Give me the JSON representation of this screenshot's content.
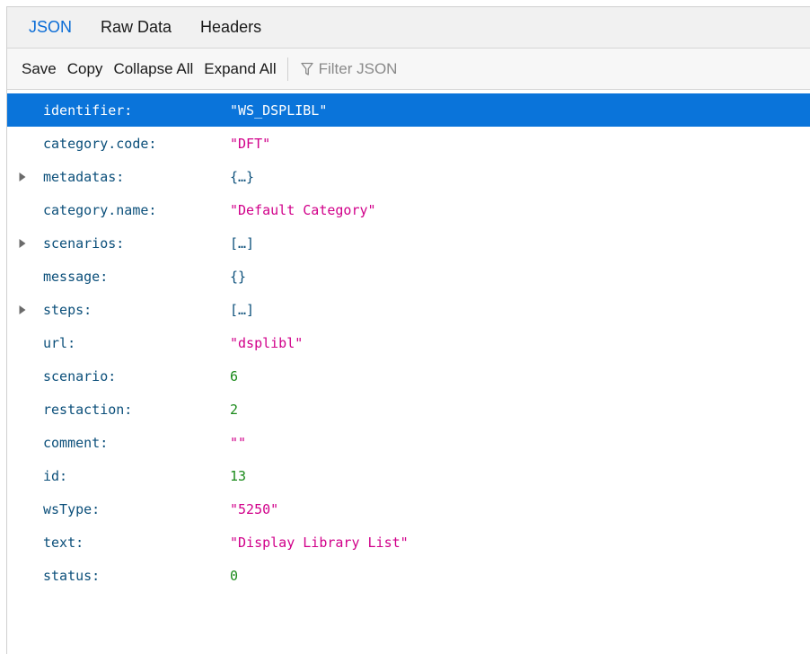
{
  "tabs": [
    {
      "label": "JSON",
      "selected": true
    },
    {
      "label": "Raw Data",
      "selected": false
    },
    {
      "label": "Headers",
      "selected": false
    }
  ],
  "toolbar": {
    "save_label": "Save",
    "copy_label": "Copy",
    "collapse_label": "Collapse All",
    "expand_label": "Expand All",
    "filter_placeholder": "Filter JSON",
    "filter_icon": "funnel-icon"
  },
  "colors": {
    "accent": "#0a6cd6",
    "selected_row": "#0a74da",
    "key": "#0b4f7a",
    "string": "#d1008a",
    "number": "#1a8a1a"
  },
  "rows": [
    {
      "key": "identifier:",
      "value": "\"WS_DSPLIBL\"",
      "type": "string",
      "expandable": false,
      "selected": true
    },
    {
      "key": "category.code:",
      "value": "\"DFT\"",
      "type": "string",
      "expandable": false,
      "selected": false
    },
    {
      "key": "metadatas:",
      "value": "{…}",
      "type": "object",
      "expandable": true,
      "selected": false
    },
    {
      "key": "category.name:",
      "value": "\"Default Category\"",
      "type": "string",
      "expandable": false,
      "selected": false
    },
    {
      "key": "scenarios:",
      "value": "[…]",
      "type": "object",
      "expandable": true,
      "selected": false
    },
    {
      "key": "message:",
      "value": "{}",
      "type": "object",
      "expandable": false,
      "selected": false
    },
    {
      "key": "steps:",
      "value": "[…]",
      "type": "object",
      "expandable": true,
      "selected": false
    },
    {
      "key": "url:",
      "value": "\"dsplibl\"",
      "type": "string",
      "expandable": false,
      "selected": false
    },
    {
      "key": "scenario:",
      "value": "6",
      "type": "number",
      "expandable": false,
      "selected": false
    },
    {
      "key": "restaction:",
      "value": "2",
      "type": "number",
      "expandable": false,
      "selected": false
    },
    {
      "key": "comment:",
      "value": "\"\"",
      "type": "string",
      "expandable": false,
      "selected": false
    },
    {
      "key": "id:",
      "value": "13",
      "type": "number",
      "expandable": false,
      "selected": false
    },
    {
      "key": "wsType:",
      "value": "\"5250\"",
      "type": "string",
      "expandable": false,
      "selected": false
    },
    {
      "key": "text:",
      "value": "\"Display Library List\"",
      "type": "string",
      "expandable": false,
      "selected": false
    },
    {
      "key": "status:",
      "value": "0",
      "type": "number",
      "expandable": false,
      "selected": false
    }
  ]
}
